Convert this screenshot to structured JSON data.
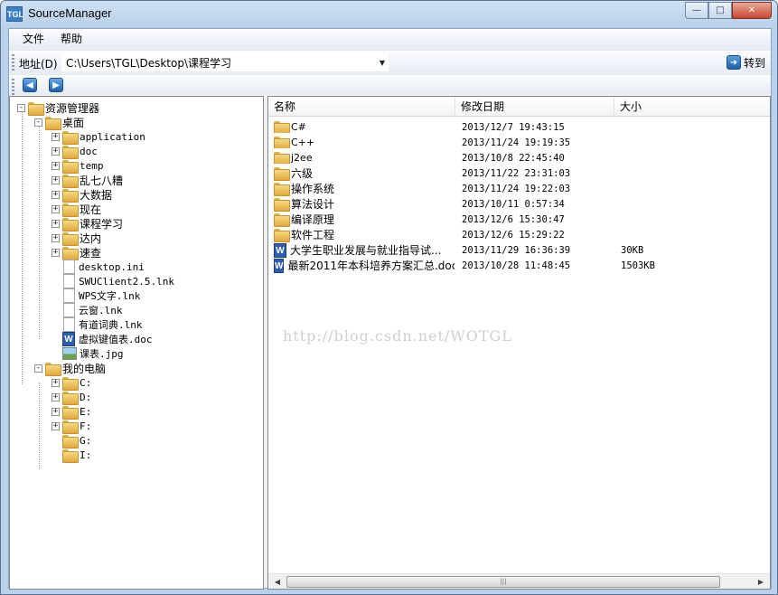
{
  "window": {
    "title": "SourceManager",
    "icon_text": "TGL"
  },
  "caption_buttons": {
    "minimize": "—",
    "maximize": "□",
    "close": "✕"
  },
  "menu": {
    "items": [
      "文件",
      "帮助"
    ]
  },
  "address": {
    "label": "地址(D)",
    "value": "C:\\Users\\TGL\\Desktop\\课程学习",
    "goto_label": "转到"
  },
  "tree": {
    "root": "资源管理器",
    "desktop": "桌面",
    "desktop_items": [
      "application",
      "doc",
      "temp",
      "乱七八糟",
      "大数据",
      "现在",
      "课程学习",
      "达内",
      "速查"
    ],
    "desktop_files": [
      "desktop.ini",
      "SWUClient2.5.lnk",
      "WPS文字.lnk",
      "云窗.lnk",
      "有道词典.lnk",
      "虚拟键值表.doc",
      "课表.jpg"
    ],
    "computer": "我的电脑",
    "drives": [
      "C:",
      "D:",
      "E:",
      "F:",
      "G:",
      "I:"
    ]
  },
  "list": {
    "columns": [
      "名称",
      "修改日期",
      "大小"
    ],
    "rows": [
      {
        "name": "C#",
        "date": "2013/12/7 19:43:15",
        "size": "",
        "type": "folder"
      },
      {
        "name": "C++",
        "date": "2013/11/24 19:19:35",
        "size": "",
        "type": "folder"
      },
      {
        "name": "j2ee",
        "date": "2013/10/8 22:45:40",
        "size": "",
        "type": "folder"
      },
      {
        "name": "六级",
        "date": "2013/11/22 23:31:03",
        "size": "",
        "type": "folder"
      },
      {
        "name": "操作系统",
        "date": "2013/11/24 19:22:03",
        "size": "",
        "type": "folder"
      },
      {
        "name": "算法设计",
        "date": "2013/10/11 0:57:34",
        "size": "",
        "type": "folder"
      },
      {
        "name": "编译原理",
        "date": "2013/12/6 15:30:47",
        "size": "",
        "type": "folder"
      },
      {
        "name": "软件工程",
        "date": "2013/12/6 15:29:22",
        "size": "",
        "type": "folder"
      },
      {
        "name": "大学生职业发展与就业指导试...",
        "date": "2013/11/29 16:36:39",
        "size": "30KB",
        "type": "word"
      },
      {
        "name": "最新2011年本科培养方案汇总.doc",
        "date": "2013/10/28 11:48:45",
        "size": "1503KB",
        "type": "word"
      }
    ]
  },
  "watermark": "http://blog.csdn.net/WOTGL",
  "colors": {
    "titlebar": "#b9d1ea",
    "close_button": "#c84531",
    "folder": "#e2a93a",
    "word": "#2b5fb4"
  }
}
